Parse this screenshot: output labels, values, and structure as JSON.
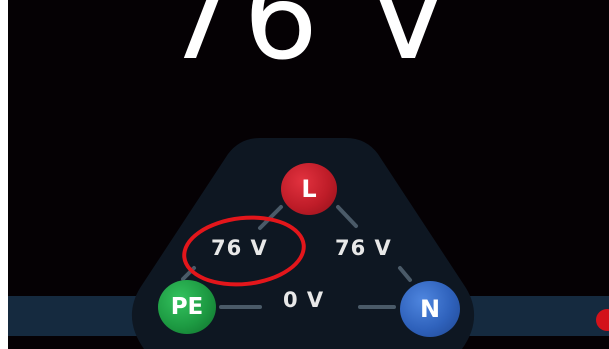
{
  "display": {
    "main_reading": "76 V"
  },
  "terminals": {
    "live": {
      "label": "L",
      "color": "#be1c28"
    },
    "protective_earth": {
      "label": "PE",
      "color": "#1d9a42"
    },
    "neutral": {
      "label": "N",
      "color": "#2f62bc"
    }
  },
  "measurements": {
    "l_pe": "76 V",
    "l_n": "76 V",
    "pe_n": "0 V"
  },
  "colors": {
    "screen_background": "#050104",
    "panel_background": "#152a3f",
    "annotation": "#e3161b",
    "status_indicator": "#d3121b"
  }
}
